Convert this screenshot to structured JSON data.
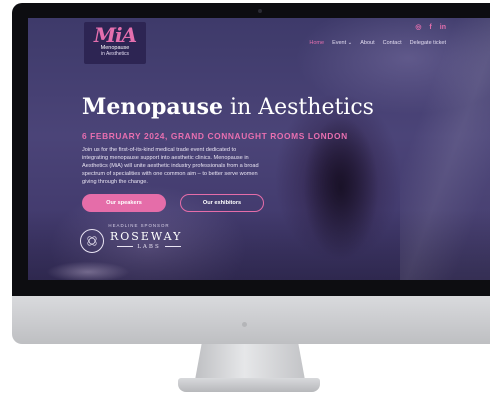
{
  "logo": {
    "mark": "MiA",
    "line1": "Menopause",
    "line2": "in Aesthetics"
  },
  "social": {
    "instagram": "◎",
    "facebook": "f",
    "linkedin": "in"
  },
  "nav": {
    "home": "Home",
    "event": "Event ⌄",
    "about": "About",
    "contact": "Contact",
    "ticket": "Delegate ticket"
  },
  "hero": {
    "title_bold": "Menopause",
    "title_light": " in Aesthetics",
    "date": "6 FEBRUARY 2024, GRAND CONNAUGHT ROOMS LONDON",
    "description": "Join us for the first-of-its-kind medical trade event dedicated to integrating menopause support into aesthetic clinics. Menopause in Aesthetics (MiA) will unite aesthetic industry professionals from a broad spectrum of specialities with one common aim – to better serve women giving through the change.",
    "btn_speakers": "Our speakers",
    "btn_exhibitors": "Our exhibitors"
  },
  "sponsor": {
    "label": "HEADLINE SPONSOR",
    "name": "ROSEWAY",
    "sub": "LABS"
  },
  "colors": {
    "accent": "#e56da9",
    "background": "#3e3a6a"
  }
}
